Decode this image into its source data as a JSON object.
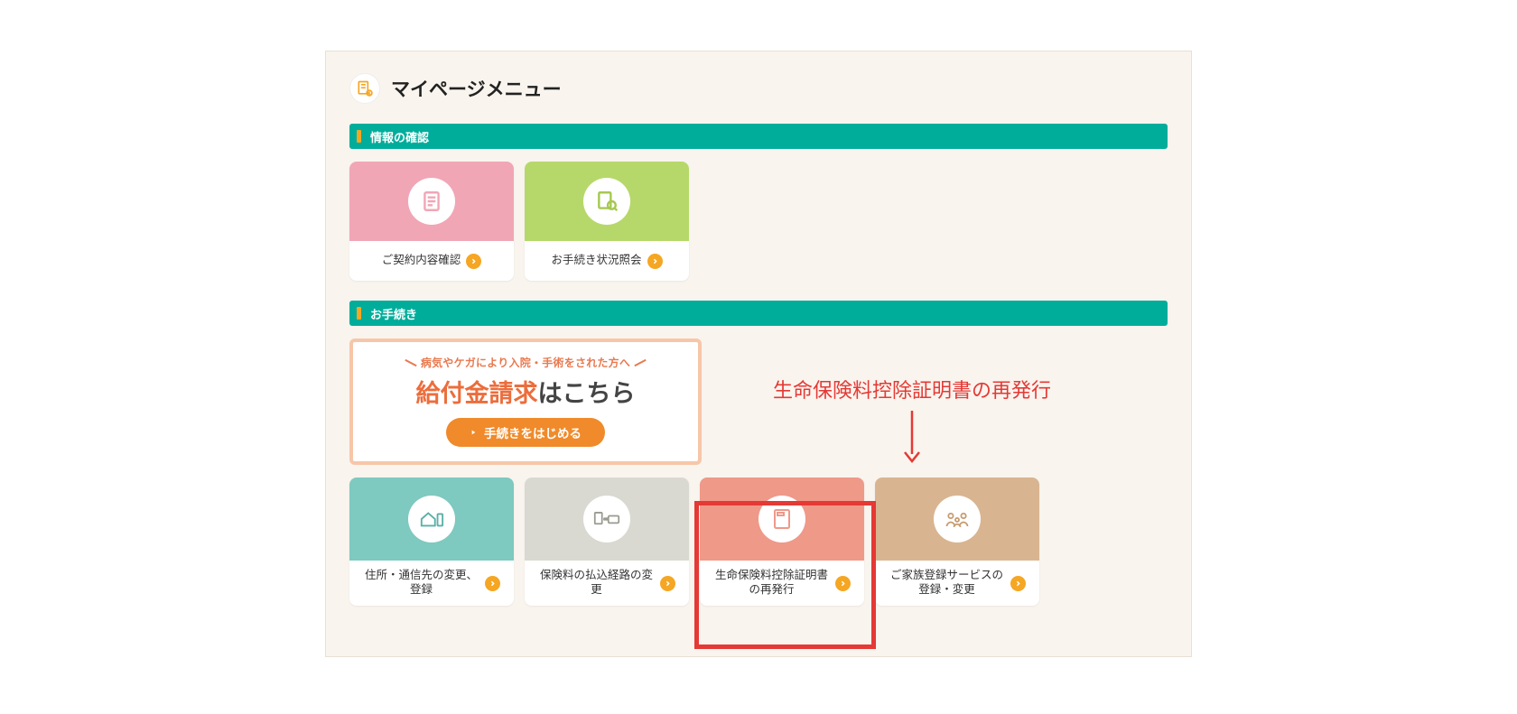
{
  "page_title": "マイページメニュー",
  "sections": {
    "info": {
      "label": "情報の確認"
    },
    "proc": {
      "label": "お手続き"
    }
  },
  "info_cards": {
    "contract": {
      "label": "ご契約内容確認"
    },
    "status": {
      "label": "お手続き状況照会"
    }
  },
  "banner": {
    "tagline": "病気やケガにより入院・手術をされた方へ",
    "accent": "給付金請求",
    "rest": "はこちら",
    "button": "手続きをはじめる"
  },
  "proc_cards": {
    "address": {
      "label": "住所・通信先の変更、登録"
    },
    "payment": {
      "label": "保険料の払込経路の変更"
    },
    "cert": {
      "label": "生命保険料控除証明書の再発行"
    },
    "family": {
      "label": "ご家族登録サービスの登録・変更"
    }
  },
  "annotation": {
    "text": "生命保険料控除証明書の再発行"
  }
}
